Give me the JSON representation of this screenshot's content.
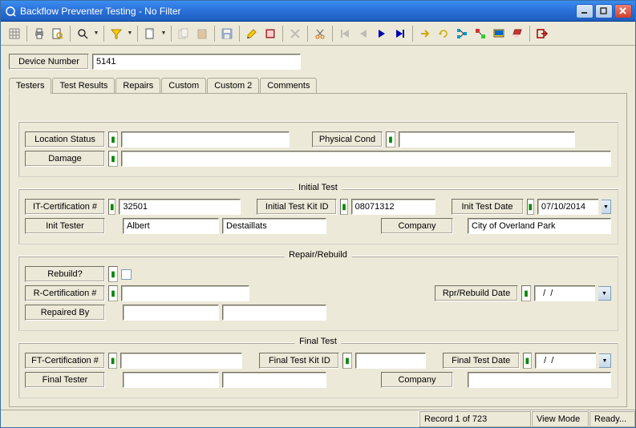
{
  "window": {
    "title": "Backflow Preventer Testing - No Filter"
  },
  "header": {
    "device_label": "Device Number",
    "device_value": "5141"
  },
  "tabs": [
    {
      "label": "Testers",
      "active": true
    },
    {
      "label": "Test Results"
    },
    {
      "label": "Repairs"
    },
    {
      "label": "Custom"
    },
    {
      "label": "Custom 2"
    },
    {
      "label": "Comments"
    }
  ],
  "locphys": {
    "location_label": "Location Status",
    "location_value": "",
    "physical_label": "Physical Cond",
    "physical_value": "",
    "damage_label": "Damage",
    "damage_value": ""
  },
  "initial": {
    "box_title": "Initial Test",
    "cert_label": "IT-Certification #",
    "cert_value": "32501",
    "kit_label": "Initial Test Kit ID",
    "kit_value": "08071312",
    "date_label": "Init Test Date",
    "date_value": "07/10/2014",
    "tester_label": "Init Tester",
    "tester_first": "Albert",
    "tester_last": "Destaillats",
    "company_label": "Company",
    "company_value": "City of Overland Park"
  },
  "repair": {
    "box_title": "Repair/Rebuild",
    "rebuild_label": "Rebuild?",
    "cert_label": "R-Certification #",
    "cert_value": "",
    "date_label": "Rpr/Rebuild Date",
    "date_value": "  /  /",
    "by_label": "Repaired By",
    "by_first": "",
    "by_last": ""
  },
  "final": {
    "box_title": "Final Test",
    "cert_label": "FT-Certification #",
    "cert_value": "",
    "kit_label": "Final Test Kit ID",
    "kit_value": "",
    "date_label": "Final Test Date",
    "date_value": "  /  /",
    "tester_label": "Final Tester",
    "tester_first": "",
    "tester_last": "",
    "company_label": "Company",
    "company_value": ""
  },
  "status": {
    "record": "Record 1 of 723",
    "mode": "View Mode",
    "ready": "Ready..."
  }
}
